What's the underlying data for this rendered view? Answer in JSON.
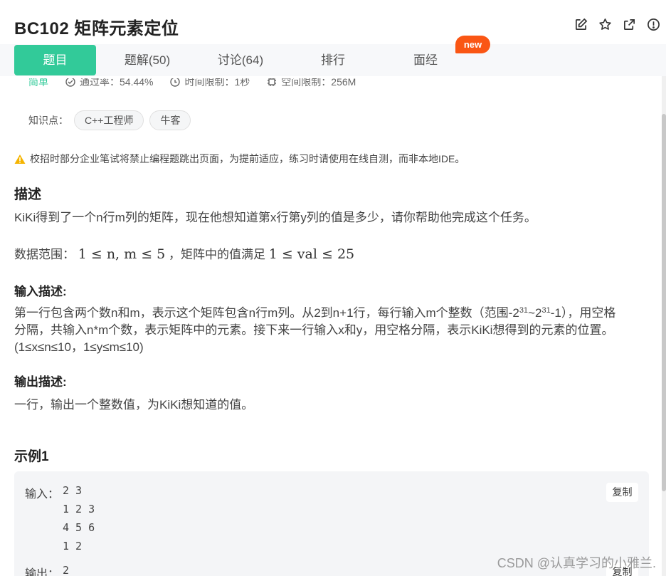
{
  "header": {
    "title": "BC102  矩阵元素定位",
    "icons": [
      "edit-icon",
      "star-icon",
      "share-icon",
      "info-icon"
    ]
  },
  "tabs": [
    {
      "label": "题目",
      "active": true
    },
    {
      "label": "题解(50)",
      "active": false
    },
    {
      "label": "讨论(64)",
      "active": false
    },
    {
      "label": "排行",
      "active": false
    },
    {
      "label": "面经",
      "active": false
    }
  ],
  "new_badge": "new",
  "meta": {
    "difficulty": "简单",
    "pass_rate": "通过率：54.44%",
    "time_limit": "时间限制：1秒",
    "space_limit": "空间限制：256M"
  },
  "knowledge": {
    "label": "知识点：",
    "tags": [
      "C++工程师",
      "牛客"
    ]
  },
  "warning": "校招时部分企业笔试将禁止编程题跳出页面，为提前适应，练习时请使用在线自测，而非本地IDE。",
  "description": {
    "heading": "描述",
    "text": "KiKi得到了一个n行m列的矩阵，现在他想知道第x行第y列的值是多少，请你帮助他完成这个任务。",
    "range_prefix": "数据范围：",
    "range_math_1": "1 ≤ n, m ≤ 5",
    "range_middle": "，矩阵中的值满足",
    "range_math_2": "1 ≤ val ≤ 25"
  },
  "input_desc": {
    "heading": "输入描述:",
    "line1_a": "第一行包含两个数n和m，表示这个矩阵包含n行m列。从2到n+1行，每行输入m个整数（范围-2",
    "exp1": "31",
    "line1_b": "~2",
    "exp2": "31",
    "line1_c": "-1），用空格",
    "line2": "分隔，共输入n*m个数，表示矩阵中的元素。接下来一行输入x和y，用空格分隔，表示KiKi想得到的元素的位置。",
    "line3": "(1≤x≤n≤10，1≤y≤m≤10)"
  },
  "output_desc": {
    "heading": "输出描述:",
    "text": "一行，输出一个整数值，为KiKi想知道的值。"
  },
  "example": {
    "heading": "示例1",
    "input_label": "输入：",
    "input_value": "2 3\n1 2 3\n4 5 6\n1 2",
    "output_label": "输出：",
    "output_value": "2",
    "copy_label": "复制"
  },
  "watermark": "CSDN @认真学习的小雅兰."
}
